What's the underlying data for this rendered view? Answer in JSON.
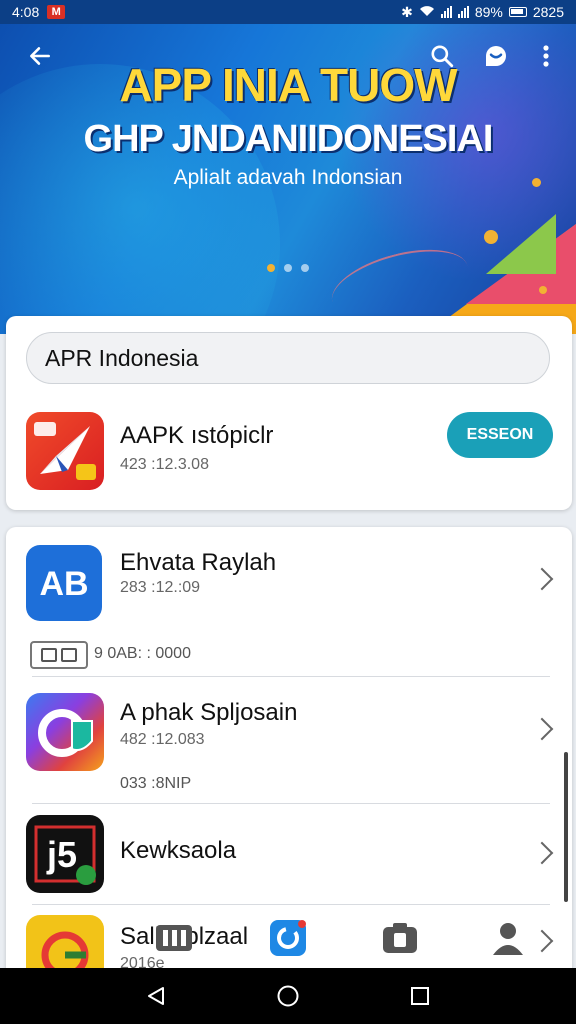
{
  "status_bar": {
    "time_left": "4:08",
    "mail_badge": "M",
    "battery_percent": "89%",
    "time_right": "2825"
  },
  "banner": {
    "title": "APP INIA TUOW",
    "subtitle": "GHP JNDANIIDONESIAI",
    "tagline": "Aplialt adavah Indonsian",
    "page_count": 3,
    "active_page": 1
  },
  "search": {
    "value": "APR Indonesia"
  },
  "featured_app": {
    "name": "AAPK ıstópiclr",
    "meta": "423 :12.3.08",
    "button_label": "ESSEON",
    "icon": "paper-plane-icon",
    "icon_colors": [
      "#e0312b",
      "#f26c2a"
    ]
  },
  "list": {
    "items": [
      {
        "name": "Ehvata Raylah",
        "meta": "283 :12.:09",
        "icon": "ab-logo-icon",
        "color": "#1e6fd9"
      },
      {
        "name": "A phak Spljosain",
        "meta": "482 :12.083",
        "icon": "c-shield-icon",
        "color": "#7b3fe0"
      },
      {
        "name": "Kewksaola",
        "meta": "",
        "icon": "j5-logo-icon",
        "color": "#111111"
      },
      {
        "name": "Salllb plzaal",
        "meta": "2016e",
        "icon": "g-circle-icon",
        "color": "#f2c318"
      }
    ],
    "tag_text": "9 0AB: : 0000",
    "extra_meta": "033 :8NIP"
  },
  "colors": {
    "accent": "#1aa0b8",
    "banner_title": "#ffd83a",
    "status_bar": "#0c3f86"
  }
}
